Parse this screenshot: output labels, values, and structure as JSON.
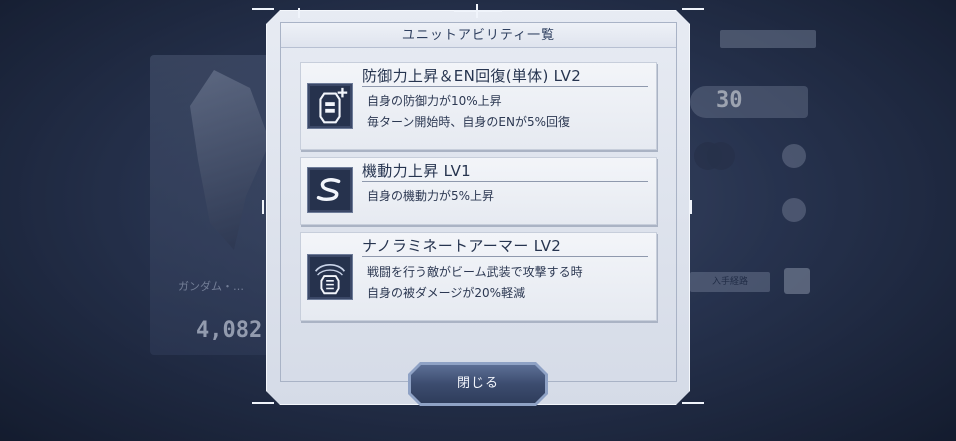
{
  "modal": {
    "title": "ユニットアビリティ一覧",
    "close_label": "閉じる"
  },
  "abilities": [
    {
      "icon": "defense-en-recovery-icon",
      "title": "防御力上昇＆EN回復(単体) LV2",
      "lines": [
        "自身の防御力が10%上昇",
        "毎ターン開始時、自身のENが5%回復"
      ]
    },
    {
      "icon": "mobility-icon",
      "title": "機動力上昇 LV1",
      "lines": [
        "自身の機動力が5%上昇"
      ]
    },
    {
      "icon": "nanolaminate-armor-icon",
      "title": "ナノラミネートアーマー LV2",
      "lines": [
        "戦闘を行う敵がビーム武装で攻撃する時",
        "自身の被ダメージが20%軽減"
      ]
    }
  ],
  "background": {
    "unit_name": "ガンダム・…",
    "power": "4,082",
    "level": "30",
    "filter_label": "入手経路"
  },
  "colors": {
    "frame": "#e3e8f1",
    "card": "#eef1f6",
    "icon_bg": "#26324d",
    "text": "#26344f",
    "button": "#3c4c6f"
  }
}
